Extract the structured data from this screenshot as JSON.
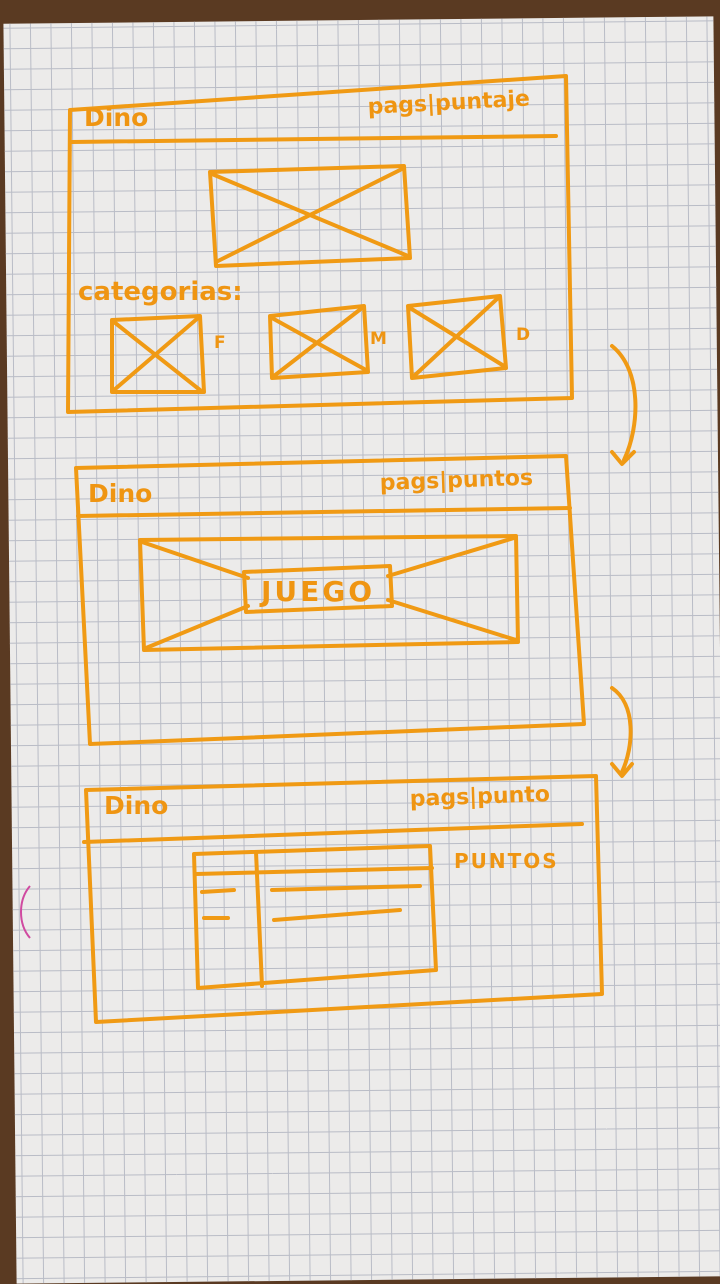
{
  "ink_color": "#f09a14",
  "paper_color": "#ecebea",
  "screens": [
    {
      "title": "Dino",
      "nav": "pags|puntaje",
      "categories_label": "categorias:",
      "categories": [
        "F",
        "M",
        "D"
      ]
    },
    {
      "title": "Dino",
      "nav": "pags|puntos",
      "game_label": "JUEGO"
    },
    {
      "title": "Dino",
      "nav": "pags|punto",
      "table_label": "PUNTOS"
    }
  ]
}
